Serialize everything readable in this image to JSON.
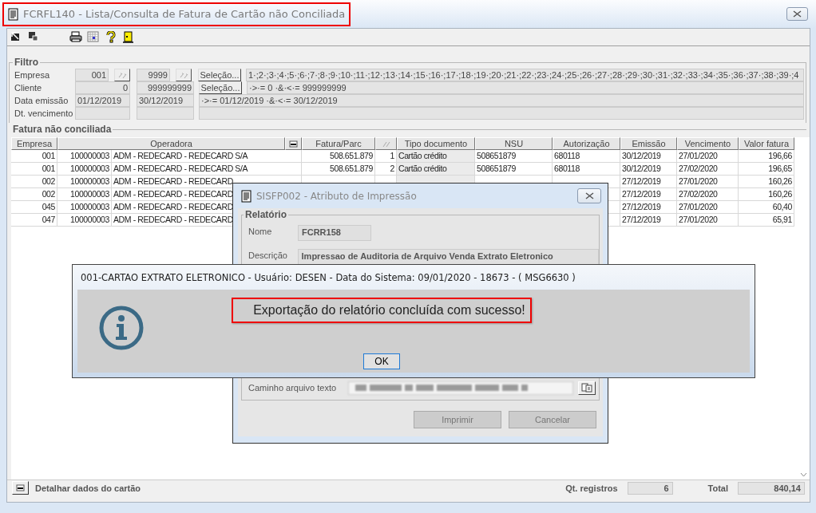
{
  "window": {
    "title": "FCRFL140 - Lista/Consulta de Fatura de Cartão não Conciliada"
  },
  "filter": {
    "title": "Filtro",
    "rows": [
      {
        "kind": "code",
        "label": "Empresa",
        "from": "001",
        "to": "9999",
        "button": "Seleção...",
        "expression": "1·;2·;3·;4·;5·;6·;7·;8·;9·;10·;11·;12·;13·;14·;15·;16·;17·;18·;19·;20·;21·;22·;23·;24·;25·;26·;27·;28·;29·;30·;31·;32·;33·;34·;35·;36·;37·;38·;39·;4"
      },
      {
        "kind": "number",
        "label": "Cliente",
        "from": "0",
        "to": "999999999",
        "button": "Seleção...",
        "expression": "·>·= 0 ·&·<·= 999999999"
      },
      {
        "kind": "date",
        "label": "Data emissão",
        "from": "01/12/2019",
        "to": "30/12/2019",
        "expression": "·>·= 01/12/2019 ·&·<·= 30/12/2019"
      },
      {
        "kind": "date",
        "label": "Dt. vencimento"
      }
    ]
  },
  "table": {
    "title": "Fatura não conciliada",
    "columns": [
      "Empresa",
      "Operadora",
      "Fatura/Parc",
      "Tipo documento",
      "NSU",
      "Autorização",
      "Emissão",
      "Vencimento",
      "Valor fatura"
    ],
    "rows": [
      {
        "empresa": "001",
        "codigo": "100000003",
        "operadora": "ADM - REDECARD - REDECARD S/A",
        "fatura": "508.651.879",
        "parc": "1",
        "tipo": "Cartão crédito",
        "nsu": "508651879",
        "autorizacao": "680118",
        "emissao": "30/12/2019",
        "vencimento": "27/01/2020",
        "valor": "196,66"
      },
      {
        "empresa": "001",
        "codigo": "100000003",
        "operadora": "ADM - REDECARD - REDECARD S/A",
        "fatura": "508.651.879",
        "parc": "2",
        "tipo": "Cartão crédito",
        "nsu": "508651879",
        "autorizacao": "680118",
        "emissao": "30/12/2019",
        "vencimento": "27/02/2020",
        "valor": "196,65"
      },
      {
        "empresa": "002",
        "codigo": "100000003",
        "operadora": "ADM - REDECARD - REDECARD",
        "emissao": "27/12/2019",
        "vencimento": "27/01/2020",
        "valor": "160,26"
      },
      {
        "empresa": "002",
        "codigo": "100000003",
        "operadora": "ADM - REDECARD - REDECARD",
        "emissao": "27/12/2019",
        "vencimento": "27/02/2020",
        "valor": "160,26"
      },
      {
        "empresa": "045",
        "codigo": "100000003",
        "operadora": "ADM - REDECARD - REDECARD",
        "emissao": "27/12/2019",
        "vencimento": "27/01/2020",
        "valor": "60,40"
      },
      {
        "empresa": "047",
        "codigo": "100000003",
        "operadora": "ADM - REDECARD - REDECARD",
        "emissao": "27/12/2019",
        "vencimento": "27/01/2020",
        "valor": "65,91"
      }
    ]
  },
  "footer": {
    "detail_label": "Detalhar dados do cartão",
    "count_label": "Qt. registros",
    "count": "6",
    "total_label": "Total",
    "total": "840,14"
  },
  "dialog": {
    "title": "SISFP002 - Atributo de Impressão",
    "group": "Relatório",
    "fields": [
      {
        "label": "Nome",
        "value": "FCRR158"
      },
      {
        "label": "Descrição",
        "value": "Impressao de Auditoria de Arquivo Venda Extrato Eletronico"
      }
    ],
    "path_label": "Caminho arquivo texto",
    "buttons": [
      {
        "label": "Imprimir",
        "disabled": true
      },
      {
        "label": "Cancelar",
        "disabled": true
      }
    ]
  },
  "message": {
    "title": "001-CARTAO EXTRATO ELETRONICO - Usuário: DESEN - Data do Sistema: 09/01/2020 - 18673 - ( MSG6630 )",
    "text": "Exportação do relatório concluída com sucesso!",
    "button": "OK"
  }
}
